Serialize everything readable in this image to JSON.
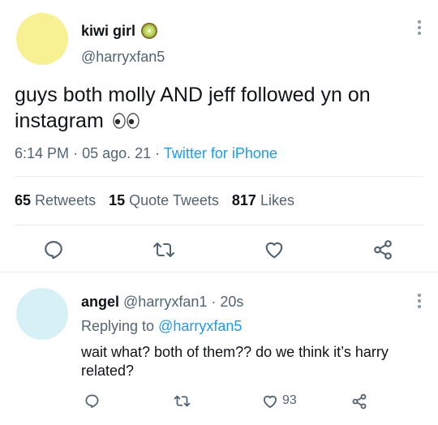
{
  "main_tweet": {
    "author_name": "kiwi girl",
    "author_handle": "@harryxfan5",
    "text": "guys both molly AND jeff followed yn on instagram",
    "time": "6:14 PM",
    "date": "05 ago. 21",
    "source": "Twitter for iPhone",
    "stats": {
      "retweets_count": "65",
      "retweets_label": "Retweets",
      "quotes_count": "15",
      "quotes_label": "Quote Tweets",
      "likes_count": "817",
      "likes_label": "Likes"
    }
  },
  "reply": {
    "author_name": "angel",
    "author_handle": "@harryxfan1",
    "time_ago": "20s",
    "replying_label": "Replying to",
    "replying_to": "@harryxfan5",
    "text": "wait what? both of them?? do we think it’s harry related?",
    "like_count": "93"
  },
  "colors": {
    "accent": "#1d9bf0",
    "muted": "#536471",
    "main_avatar": "#f8f194",
    "reply_avatar": "#d6f1f6"
  },
  "icons": [
    "kiwi-icon",
    "eyes-emoji-icon",
    "more-icon",
    "reply-icon",
    "retweet-icon",
    "like-icon",
    "share-icon"
  ]
}
